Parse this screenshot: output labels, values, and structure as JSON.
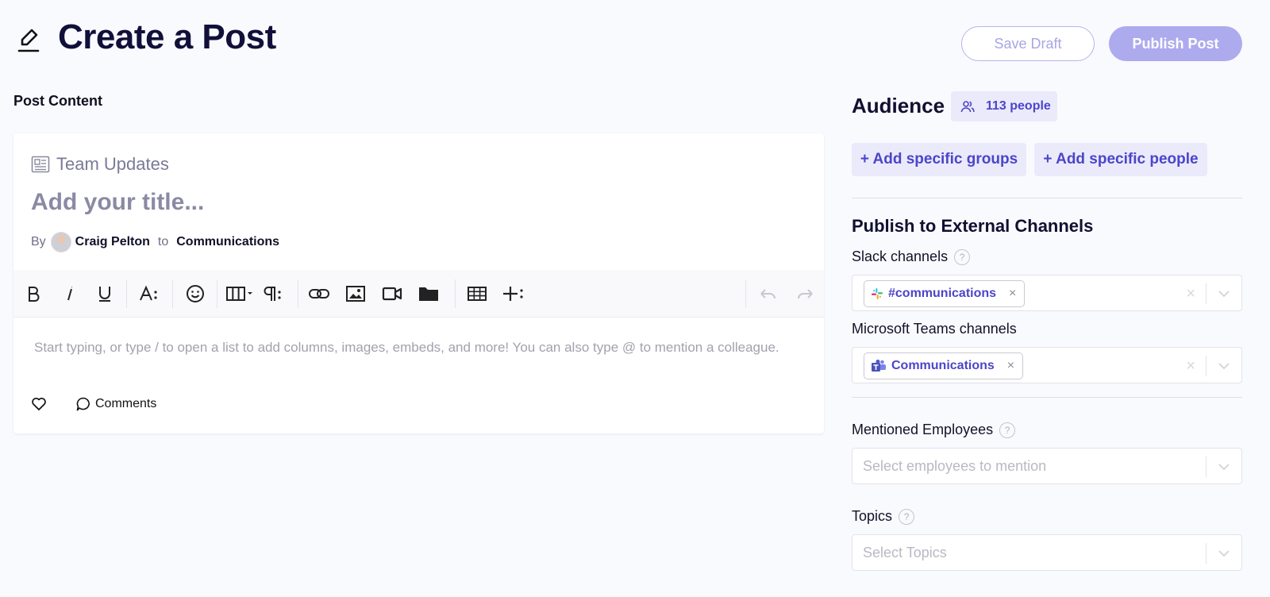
{
  "header": {
    "title": "Create a Post",
    "save_draft_label": "Save Draft",
    "publish_label": "Publish Post"
  },
  "content": {
    "section_label": "Post Content",
    "channel": "Team Updates",
    "title_placeholder": "Add your title...",
    "by_label": "By",
    "author": "Craig Pelton",
    "to_label": "to",
    "recipient": "Communications",
    "toolbar": [
      "bold-icon",
      "italic-icon",
      "underline-icon",
      "font-size-icon",
      "emoji-icon",
      "columns-icon",
      "paragraph-icon",
      "link-icon",
      "image-icon",
      "video-icon",
      "folder-icon",
      "table-icon",
      "insert-icon",
      "undo-icon",
      "redo-icon"
    ],
    "body_placeholder": "Start typing, or type / to open a list to add columns, images, embeds, and more! You can also type @ to mention a colleague.",
    "comments_label": "Comments"
  },
  "audience": {
    "title": "Audience",
    "count_label": "113 people",
    "add_groups_label": "+ Add specific groups",
    "add_people_label": "+ Add specific people"
  },
  "external": {
    "title": "Publish to External Channels",
    "slack_label": "Slack channels",
    "slack_chip": "#communications",
    "teams_label": "Microsoft Teams channels",
    "teams_chip": "Communications",
    "chip_remove": "×",
    "clear": "×"
  },
  "mentions": {
    "label": "Mentioned Employees",
    "placeholder": "Select employees to mention"
  },
  "topics": {
    "label": "Topics",
    "placeholder": "Select Topics"
  },
  "help_glyph": "?",
  "colors": {
    "accent": "#4c45c9",
    "accent_light": "#ebeafb",
    "publish_bg": "#aeaaee",
    "background": "#f9fafe"
  }
}
